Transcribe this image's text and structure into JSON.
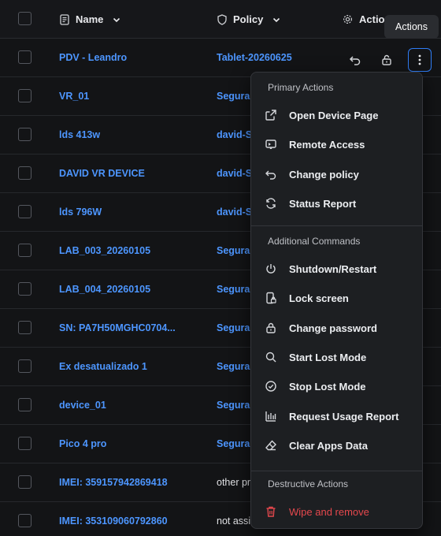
{
  "table": {
    "headers": {
      "name": "Name",
      "policy": "Policy",
      "actions": "Actio"
    },
    "rows": [
      {
        "name": "PDV - Leandro",
        "policy": "Tablet-20260625",
        "policy_style": "link"
      },
      {
        "name": "VR_01",
        "policy": "Segura",
        "policy_style": "link"
      },
      {
        "name": "lds 413w",
        "policy": "david-S",
        "policy_style": "link"
      },
      {
        "name": "DAVID VR DEVICE",
        "policy": "david-S",
        "policy_style": "link"
      },
      {
        "name": "lds 796W",
        "policy": "david-S",
        "policy_style": "link"
      },
      {
        "name": "LAB_003_20260105",
        "policy": "Segura",
        "policy_style": "link"
      },
      {
        "name": "LAB_004_20260105",
        "policy": "Segura",
        "policy_style": "link"
      },
      {
        "name": "SN: PA7H50MGHC0704...",
        "policy": "Segura",
        "policy_style": "link"
      },
      {
        "name": "Ex desatualizado 1",
        "policy": "Segura",
        "policy_style": "link"
      },
      {
        "name": "device_01",
        "policy": "Segura",
        "policy_style": "link"
      },
      {
        "name": "Pico 4 pro",
        "policy": "Segura",
        "policy_style": "link"
      },
      {
        "name": "IMEI: 359157942869418",
        "policy": "other pr",
        "policy_style": "plain"
      },
      {
        "name": "IMEI: 353109060792860",
        "policy": "not assig",
        "policy_style": "plain"
      }
    ]
  },
  "tooltip": "Actions",
  "menu": {
    "sections": [
      {
        "title": "Primary Actions",
        "items": [
          {
            "label": "Open Device Page",
            "icon": "external-link-icon"
          },
          {
            "label": "Remote Access",
            "icon": "cast-screen-icon"
          },
          {
            "label": "Change policy",
            "icon": "undo-arrow-icon"
          },
          {
            "label": "Status Report",
            "icon": "refresh-icon"
          }
        ]
      },
      {
        "title": "Additional Commands",
        "items": [
          {
            "label": "Shutdown/Restart",
            "icon": "power-icon"
          },
          {
            "label": "Lock screen",
            "icon": "phone-lock-icon"
          },
          {
            "label": "Change password",
            "icon": "lock-icon"
          },
          {
            "label": "Start Lost Mode",
            "icon": "search-icon"
          },
          {
            "label": "Stop Lost Mode",
            "icon": "check-circle-icon"
          },
          {
            "label": "Request Usage Report",
            "icon": "bar-chart-icon"
          },
          {
            "label": "Clear Apps Data",
            "icon": "eraser-icon"
          }
        ]
      },
      {
        "title": "Destructive Actions",
        "items": [
          {
            "label": "Wipe and remove",
            "icon": "trash-icon"
          }
        ]
      }
    ]
  },
  "colors": {
    "background": "#131416",
    "link": "#4d96ff",
    "accent": "#2f7df6",
    "danger": "#e5484d",
    "menu_bg": "#1d1f22"
  }
}
